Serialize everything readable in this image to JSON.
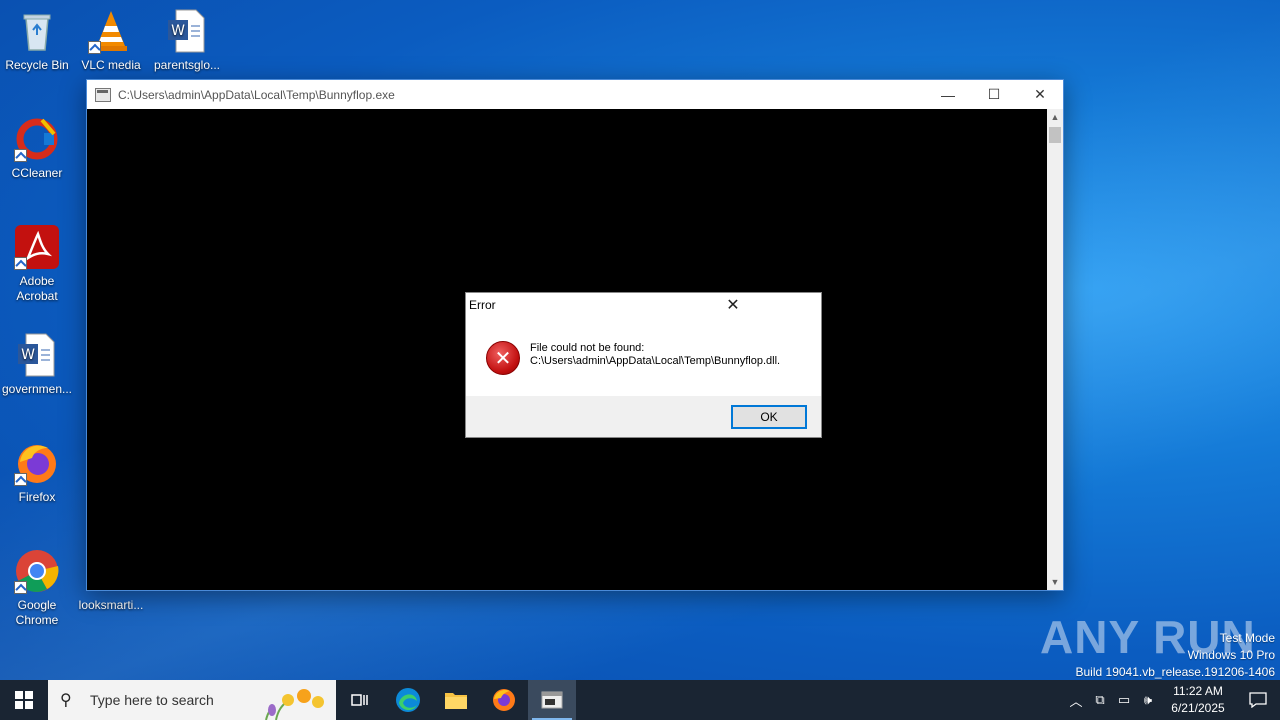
{
  "desktop": {
    "icons": [
      {
        "label": "Recycle Bin"
      },
      {
        "label": "VLC media"
      },
      {
        "label": "parentsglo..."
      },
      {
        "label": "CCleaner"
      },
      {
        "label": "Adobe Acrobat"
      },
      {
        "label": "governmen..."
      },
      {
        "label": "Firefox"
      },
      {
        "label": "Google Chrome"
      },
      {
        "label": "looksmarti..."
      }
    ]
  },
  "console_window": {
    "title": "C:\\Users\\admin\\AppData\\Local\\Temp\\Bunnyflop.exe",
    "minimize_label": "—",
    "maximize_label": "☐",
    "close_label": "✕"
  },
  "error_dialog": {
    "title": "Error",
    "close_label": "✕",
    "message_line1": "File could not be found:",
    "message_line2": "C:\\Users\\admin\\AppData\\Local\\Temp\\Bunnyflop.dll.",
    "ok_label": "OK"
  },
  "watermark": {
    "brand": "ANY RUN",
    "line1": "Test Mode",
    "line2": "Windows 10 Pro",
    "line3": "Build 19041.vb_release.191206-1406"
  },
  "taskbar": {
    "search_placeholder": "Type here to search",
    "clock_time": "11:22 AM",
    "clock_date": "6/21/2025"
  },
  "colors": {
    "accent": "#0078d7",
    "taskbar": "#1a2533",
    "error_red": "#c21010"
  }
}
